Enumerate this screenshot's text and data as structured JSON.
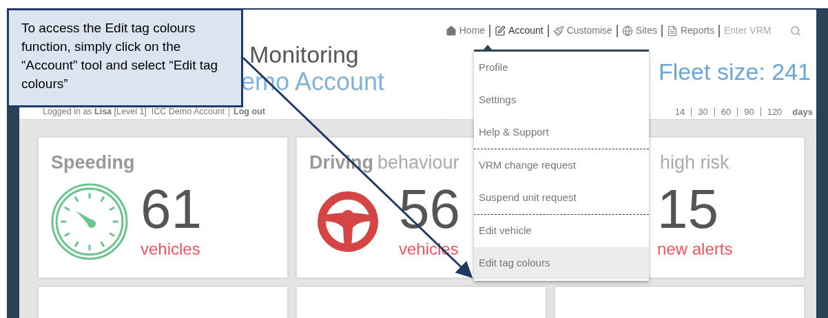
{
  "nav": [
    {
      "label": "Home",
      "selected": false
    },
    {
      "label": "Account",
      "selected": true
    },
    {
      "label": "Customise",
      "selected": false
    },
    {
      "label": "Sites",
      "selected": false
    },
    {
      "label": "Reports",
      "selected": false
    }
  ],
  "search": {
    "placeholder": "Enter VRM"
  },
  "title": "Monitoring",
  "subtitle": "emo Account",
  "login": "Logged in as **Lisa** [Level 1]  ICC Demo Account",
  "logout": "Log out",
  "fleet_size": "Fleet size: 241",
  "periods": [
    "14",
    "30",
    "60",
    "90",
    "120"
  ],
  "periods_unit": "days",
  "cards": [
    {
      "kind": "gauge",
      "title": "Speeding",
      "count": "61",
      "unit": "vehicles"
    },
    {
      "kind": "steering",
      "title": "Driving",
      "title_light": "behaviour",
      "count": "56",
      "unit": "vehicles"
    },
    {
      "kind": "hidden",
      "title_light": "high risk",
      "count": "15",
      "unit": "new alerts"
    }
  ],
  "menu": [
    [
      {
        "label": "Profile",
        "selected": false
      },
      {
        "label": "Settings",
        "selected": false
      },
      {
        "label": "Help & Support",
        "selected": false
      }
    ],
    [
      {
        "label": "VRM change request",
        "selected": false
      },
      {
        "label": "Suspend unit request",
        "selected": false
      }
    ],
    [
      {
        "label": "Edit vehicle",
        "selected": false
      },
      {
        "label": "Edit tag colours",
        "selected": true
      }
    ]
  ],
  "callout": {
    "text": "To access the Edit tag colours function, simply click on the “Account” tool and select “Edit tag colours”"
  }
}
